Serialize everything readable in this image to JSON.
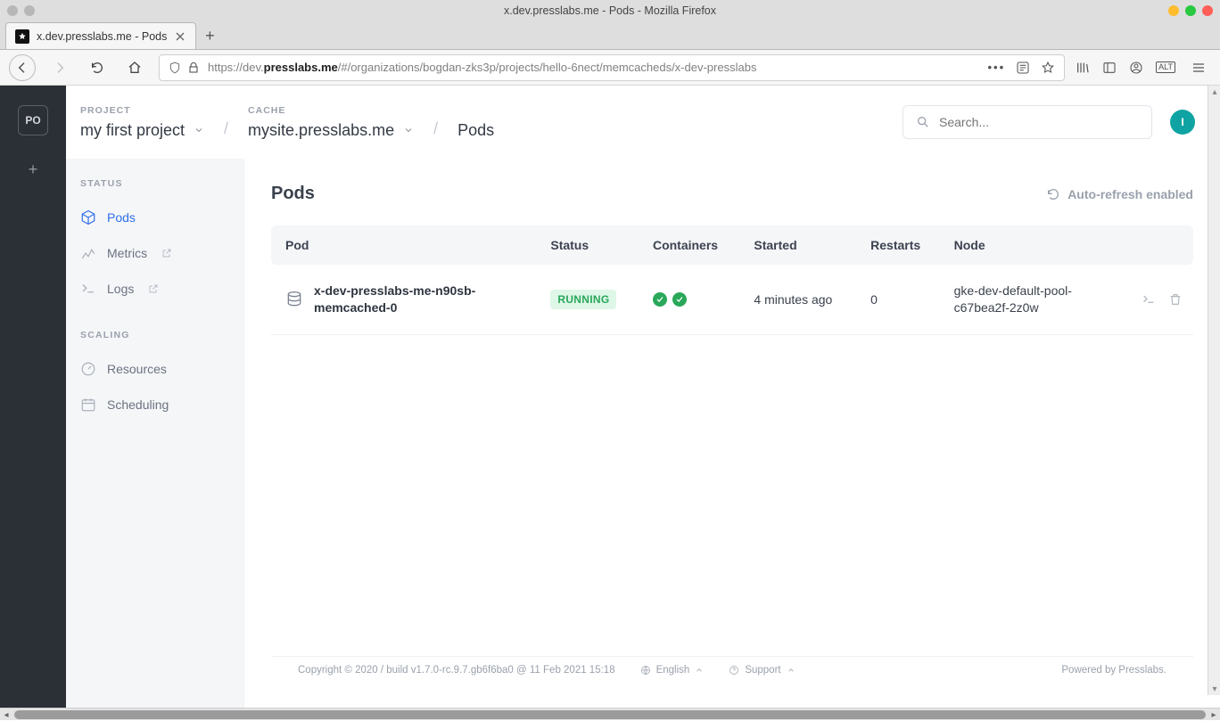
{
  "window": {
    "title": "x.dev.presslabs.me - Pods - Mozilla Firefox"
  },
  "tab": {
    "title": "x.dev.presslabs.me - Pods"
  },
  "url": {
    "prefix": "https://dev.",
    "bold": "presslabs.me",
    "suffix": "/#/organizations/bogdan-zks3p/projects/hello-6nect/memcacheds/x-dev-presslabs"
  },
  "rail": {
    "org": "PO"
  },
  "breadcrumb": {
    "project_label": "PROJECT",
    "project_value": "my first project",
    "cache_label": "CACHE",
    "cache_value": "mysite.presslabs.me",
    "page": "Pods"
  },
  "search": {
    "placeholder": "Search..."
  },
  "avatar": {
    "initial": "I"
  },
  "sidenav": {
    "section_status": "STATUS",
    "pods": "Pods",
    "metrics": "Metrics",
    "logs": "Logs",
    "section_scaling": "SCALING",
    "resources": "Resources",
    "scheduling": "Scheduling"
  },
  "main": {
    "heading": "Pods",
    "auto_refresh": "Auto-refresh enabled",
    "columns": {
      "pod": "Pod",
      "status": "Status",
      "containers": "Containers",
      "started": "Started",
      "restarts": "Restarts",
      "node": "Node"
    },
    "rows": [
      {
        "name": "x-dev-presslabs-me-n90sb-memcached-0",
        "status": "RUNNING",
        "containers_ok": 2,
        "started": "4 minutes ago",
        "restarts": "0",
        "node": "gke-dev-default-pool-c67bea2f-2z0w"
      }
    ]
  },
  "footer": {
    "copyright": "Copyright © 2020 / build v1.7.0-rc.9.7.gb6f6ba0 @ 11 Feb 2021 15:18",
    "language": "English",
    "support": "Support",
    "powered": "Powered by Presslabs."
  }
}
